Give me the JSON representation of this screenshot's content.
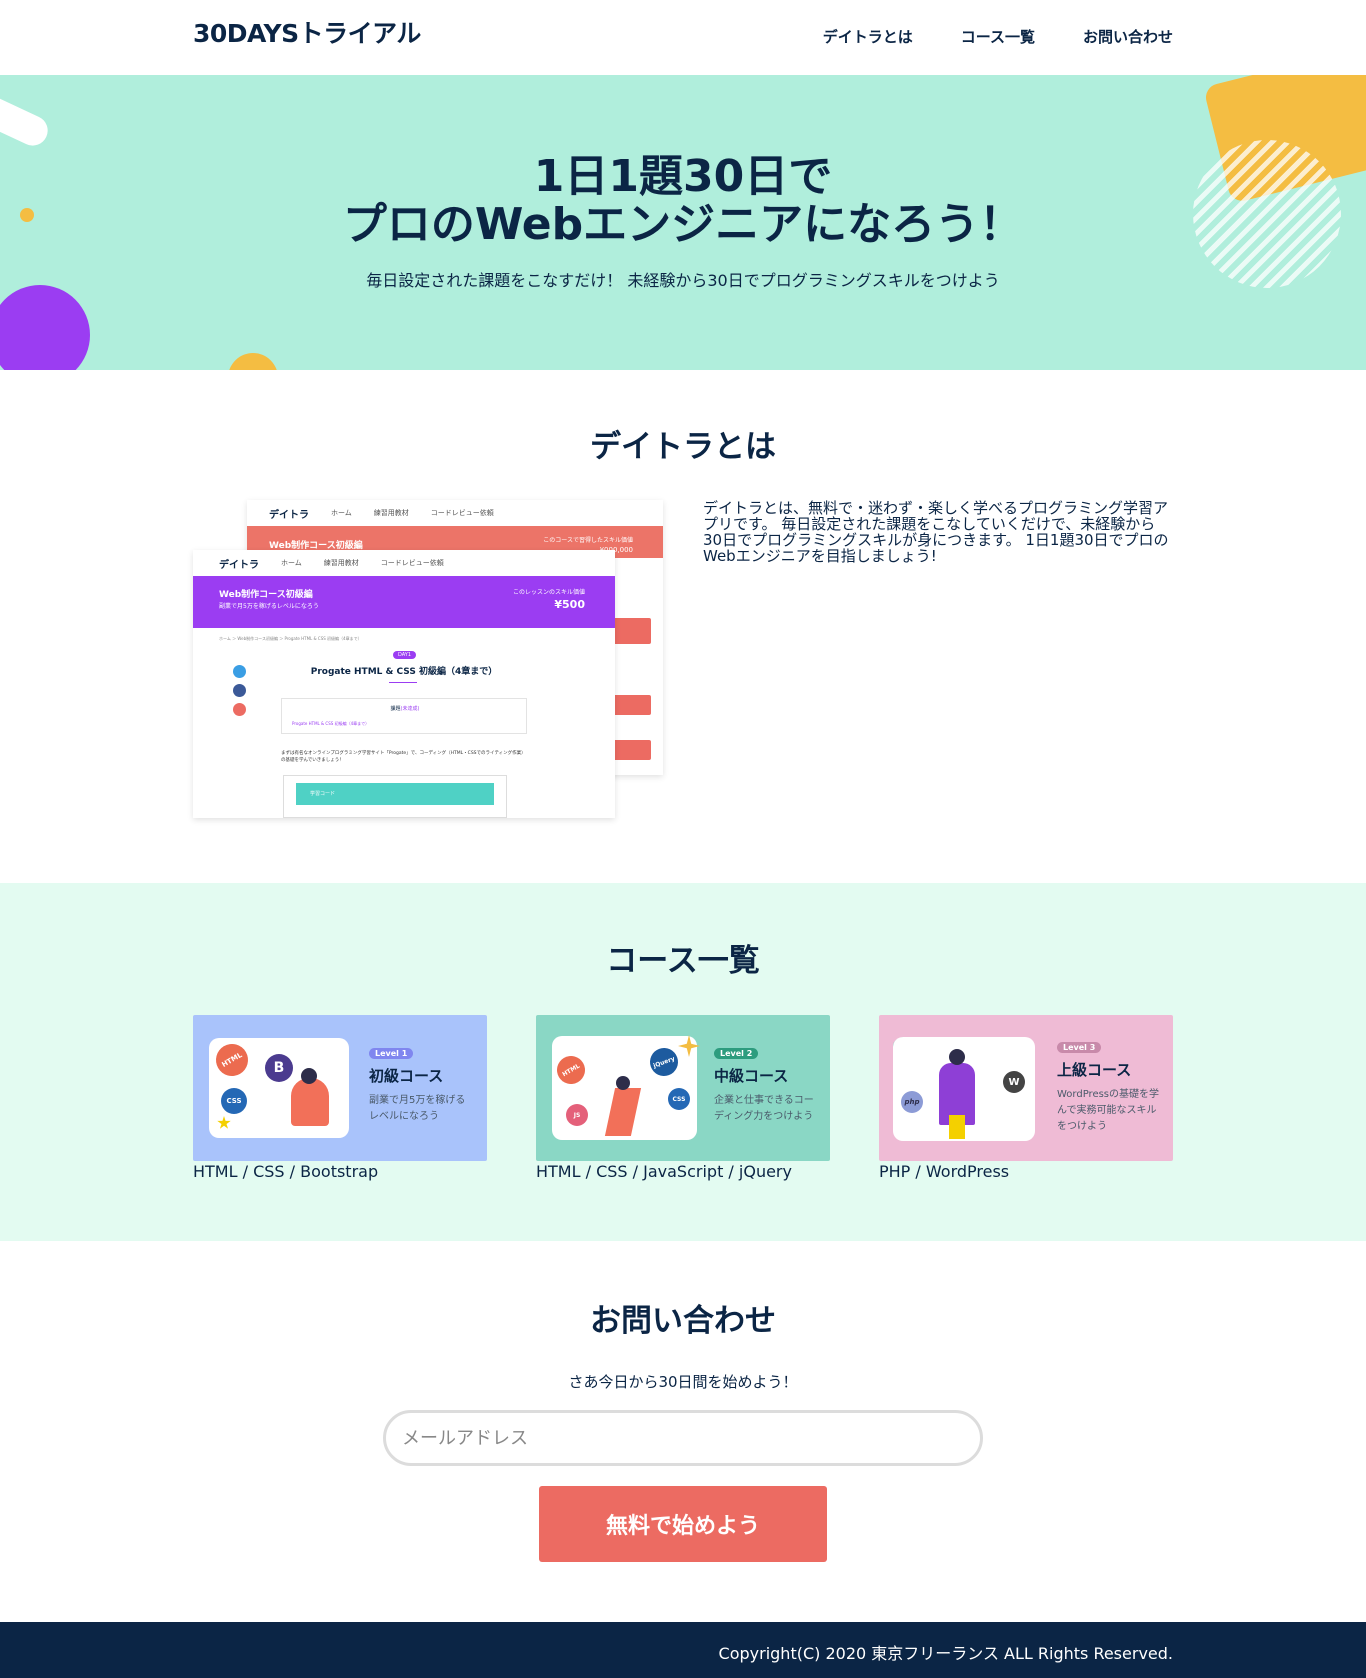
{
  "header": {
    "logo": "30DAYSトライアル",
    "nav": [
      "デイトラとは",
      "コース一覧",
      "お問い合わせ"
    ]
  },
  "hero": {
    "title_line1": "1日1題30日で",
    "title_line2": "プロのWebエンジニアになろう！",
    "subtitle": "毎日設定された課題をこなすだけ！ 未経験から30日でプログラミングスキルをつけよう"
  },
  "about": {
    "title": "デイトラとは",
    "text": "デイトラとは、無料で・迷わず・楽しく学べるプログラミング学習アプリです。 毎日設定された課題をこなしていくだけで、未経験から30日でプログラミングスキルが身につきます。 1日1題30日でプロのWebエンジニアを目指しましょう!",
    "screenshot": {
      "app_name": "デイトラ",
      "nav_items": [
        "ホーム",
        "練習用教材",
        "コードレビュー依頼"
      ],
      "back_banner": "Web制作コース初級編",
      "back_skill_label": "このコースで習得したスキル価値",
      "back_skill_value": "¥000,000",
      "front_banner": "Web制作コース初級編",
      "front_banner_sub": "副業で月5万を稼げるレベルになろう",
      "front_skill_label": "このレッスンのスキル価値",
      "front_skill_value": "¥500",
      "breadcrumb": "ホーム ＞ Web制作コース初級編 ＞ Progate HTML & CSS 初級編（4章まで）",
      "day_badge": "DAY1",
      "lesson_title": "Progate HTML & CSS 初級編（4章まで）",
      "task_heading": "課題",
      "task_status": "(未達成)",
      "task_item": "Progate HTML & CSS 初級編（4章まで）",
      "body_text": "まずは有名なオンラインプログラミング学習サイト「Progate」で、コーディング（HTML・CSSでのライティング作業）の基礎を学んでいきましょう！",
      "study_code": "学習コード"
    }
  },
  "courses": {
    "title": "コース一覧",
    "items": [
      {
        "level": "Level 1",
        "name": "初級コース",
        "desc_line1": "副業で月5万を稼げる",
        "desc_line2": "レベルになろう",
        "tags": "HTML / CSS / Bootstrap",
        "icons": [
          "HTML",
          "B",
          "CSS"
        ],
        "bg": "#a9c3fb",
        "badge_color": "#7f86ef"
      },
      {
        "level": "Level 2",
        "name": "中級コース",
        "desc_line1": "企業と仕事できるコー",
        "desc_line2": "ディング力をつけよう",
        "tags": "HTML / CSS / JavaScript / jQuery",
        "icons": [
          "HTML",
          "jQuery",
          "CSS",
          "JS"
        ],
        "bg": "#8ad7c5",
        "badge_color": "#2d9c7e"
      },
      {
        "level": "Level 3",
        "name": "上級コース",
        "desc_line1": "WordPressの基礎を学",
        "desc_line2": "んで実務可能なスキル",
        "desc_line3": "をつけよう",
        "tags": "PHP / WordPress",
        "icons": [
          "php",
          "W"
        ],
        "bg": "#efbbd5",
        "badge_color": "#c88aaa"
      }
    ]
  },
  "contact": {
    "title": "お問い合わせ",
    "lead": "さあ今日から30日間を始めよう！",
    "email_placeholder": "メールアドレス",
    "submit_label": "無料で始めよう"
  },
  "footer": {
    "copyright": "Copyright(C) 2020 東京フリーランス ALL Rights Reserved."
  },
  "colors": {
    "navy": "#0b2545",
    "hero_bg": "#b0eedc",
    "courses_bg": "#e3fbf1",
    "cta": "#ec6b62",
    "purple": "#9b3df2",
    "yellow": "#f4bd42"
  }
}
